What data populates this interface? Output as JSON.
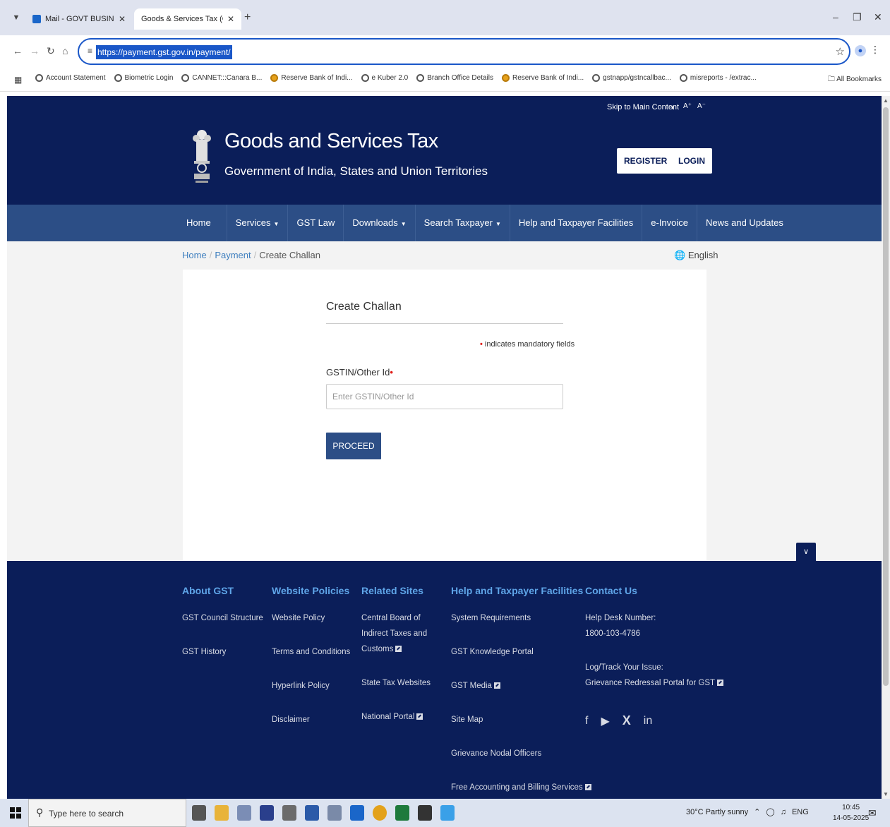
{
  "browser": {
    "tabs": [
      {
        "title": "Mail - GOVT BUSINESS SECTIO",
        "active": false
      },
      {
        "title": "Goods & Services Tax (GST) | Pa",
        "active": true
      }
    ],
    "url": "https://payment.gst.gov.in/payment/",
    "bookmarks": [
      "Account Statement",
      "Biometric Login",
      "CANNET:::Canara B...",
      "Reserve Bank of Indi...",
      "e Kuber 2.0",
      "Branch Office Details",
      "Reserve Bank of Indi...",
      "gstnapp/gstncallbac...",
      "misreports - /extrac..."
    ],
    "all_bookmarks": "All Bookmarks"
  },
  "topbar": {
    "skip": "Skip to Main Content",
    "font_up": "A⁺",
    "font_down": "A⁻"
  },
  "header": {
    "title": "Goods and Services Tax",
    "subtitle": "Government of India, States and Union Territories",
    "register": "REGISTER",
    "login": "LOGIN"
  },
  "nav": {
    "items": [
      "Home",
      "Services",
      "GST Law",
      "Downloads",
      "Search Taxpayer",
      "Help and Taxpayer Facilities",
      "e-Invoice",
      "News and Updates"
    ]
  },
  "breadcrumb": {
    "home": "Home",
    "payment": "Payment",
    "current": "Create Challan"
  },
  "language": "English",
  "form": {
    "title": "Create Challan",
    "mandatory_note": "indicates mandatory fields",
    "gstin_label": "GSTIN/Other Id",
    "gstin_placeholder": "Enter GSTIN/Other Id",
    "gstin_value": "",
    "proceed": "PROCEED"
  },
  "footer": {
    "about": {
      "heading": "About GST",
      "links": [
        "GST Council Structure",
        "GST History"
      ]
    },
    "policies": {
      "heading": "Website Policies",
      "links": [
        "Website Policy",
        "Terms and Conditions",
        "Hyperlink Policy",
        "Disclaimer"
      ]
    },
    "related": {
      "heading": "Related Sites",
      "links": [
        "Central Board of Indirect Taxes and Customs",
        "State Tax Websites",
        "National Portal"
      ]
    },
    "help": {
      "heading": "Help and Taxpayer Facilities",
      "links": [
        "System Requirements",
        "GST Knowledge Portal",
        "GST Media",
        "Site Map",
        "Grievance Nodal Officers",
        "Free Accounting and Billing Services"
      ]
    },
    "contact": {
      "heading": "Contact Us",
      "helpdesk_label": "Help Desk Number:",
      "helpdesk_number": "1800-103-4786",
      "issue_label": "Log/Track Your Issue:",
      "issue_link": "Grievance Redressal Portal for GST"
    }
  },
  "taskbar": {
    "search_placeholder": "Type here to search",
    "weather": "30°C  Partly sunny",
    "lang": "ENG",
    "time": "10:45",
    "date": "14-05-2025"
  },
  "colors": {
    "header_bg": "#0b1e59",
    "nav_bg": "#2c4e86",
    "footer_heading": "#5fa5e8",
    "link": "#3f7fbf",
    "required": "#e0201b"
  }
}
